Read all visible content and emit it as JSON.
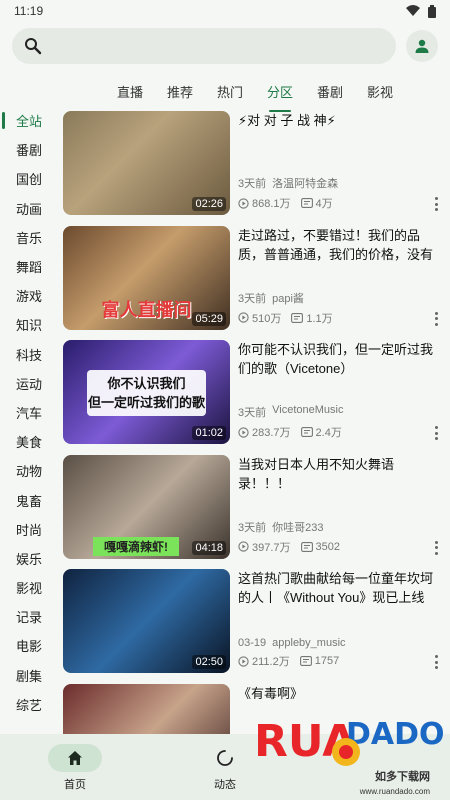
{
  "status": {
    "time": "11:19",
    "wifi_icon": "wifi-icon",
    "battery_icon": "battery-icon"
  },
  "search": {
    "placeholder": "",
    "value": ""
  },
  "tabs": [
    {
      "label": "直播"
    },
    {
      "label": "推荐"
    },
    {
      "label": "热门"
    },
    {
      "label": "分区",
      "active": true
    },
    {
      "label": "番剧"
    },
    {
      "label": "影视"
    }
  ],
  "sidebar": {
    "items": [
      {
        "label": "全站",
        "active": true
      },
      {
        "label": "番剧"
      },
      {
        "label": "国创"
      },
      {
        "label": "动画"
      },
      {
        "label": "音乐"
      },
      {
        "label": "舞蹈"
      },
      {
        "label": "游戏"
      },
      {
        "label": "知识"
      },
      {
        "label": "科技"
      },
      {
        "label": "运动"
      },
      {
        "label": "汽车"
      },
      {
        "label": "美食"
      },
      {
        "label": "动物"
      },
      {
        "label": "鬼畜"
      },
      {
        "label": "时尚"
      },
      {
        "label": "娱乐"
      },
      {
        "label": "影视"
      },
      {
        "label": "记录"
      },
      {
        "label": "电影"
      },
      {
        "label": "剧集"
      },
      {
        "label": "综艺"
      }
    ]
  },
  "videos": [
    {
      "title": "⚡对 对 子 战 神⚡",
      "time": "3天前",
      "author": "洛温阿特金森",
      "views": "868.1万",
      "danmaku": "4万",
      "duration": "02:26",
      "overlay": ""
    },
    {
      "title": "走过路过，不要错过！我们的品质，普普通通，我们的价格，没有极限...",
      "time": "3天前",
      "author": "papi酱",
      "views": "510万",
      "danmaku": "1.1万",
      "duration": "05:29",
      "overlay": "富人直播间"
    },
    {
      "title": "你可能不认识我们，但一定听过我们的歌（Vicetone）",
      "time": "3天前",
      "author": "VicetoneMusic",
      "views": "283.7万",
      "danmaku": "2.4万",
      "duration": "01:02",
      "overlay": "你不认识我们\n但一定听过我们的歌"
    },
    {
      "title": "当我对日本人用不知火舞语录！！！",
      "time": "3天前",
      "author": "你哇哥233",
      "views": "397.7万",
      "danmaku": "3502",
      "duration": "04:18",
      "overlay": "嘎嘎滴辣虾!"
    },
    {
      "title": "这首热门歌曲献给每一位童年坎坷的人丨《Without You》现已上线",
      "time": "03-19",
      "author": "appleby_music",
      "views": "211.2万",
      "danmaku": "1757",
      "duration": "02:50",
      "overlay": ""
    },
    {
      "title": "《有毒啊》",
      "time": "",
      "author": "",
      "views": "",
      "danmaku": "",
      "duration": "",
      "overlay": ""
    }
  ],
  "bottom_nav": [
    {
      "label": "首页",
      "icon": "home-icon",
      "active": true
    },
    {
      "label": "动态",
      "icon": "dynamic-icon"
    }
  ],
  "watermark": {
    "text": "RUANDADO",
    "sub": "如多下载网",
    "url": "www.ruandado.com"
  },
  "colors": {
    "accent": "#1e7a46",
    "background": "#f4f7f4"
  }
}
